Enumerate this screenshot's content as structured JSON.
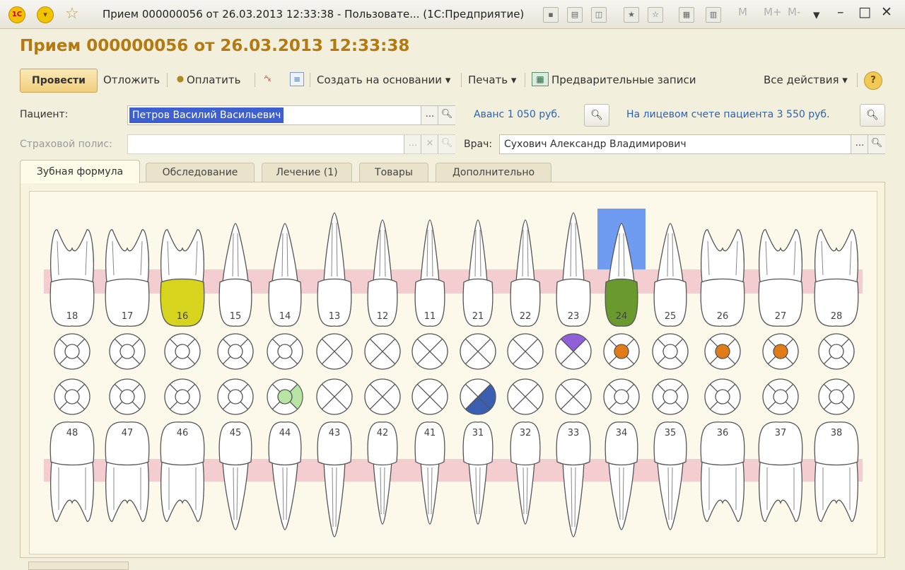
{
  "window": {
    "title": "Прием 000000056 от 26.03.2013 12:33:38 - Пользовате... (1С:Предприятие)",
    "logo_text": "1С",
    "m_buttons": [
      "M",
      "M+",
      "M-"
    ]
  },
  "document": {
    "title": "Прием 000000056 от 26.03.2013 12:33:38"
  },
  "toolbar": {
    "post_label": "Провести",
    "postpone_label": "Отложить",
    "pay_label": "Оплатить",
    "create_based_label": "Создать на основании",
    "print_label": "Печать",
    "preliminary_label": "Предварительные записи",
    "all_actions_label": "Все действия",
    "help_label": "?"
  },
  "form": {
    "patient_label": "Пациент:",
    "patient_value": "Петров Василий Васильевич",
    "advance_link": "Аванс 1 050 руб.",
    "account_link": "На лицевом счете пациента 3 550 руб.",
    "policy_label": "Страховой полис:",
    "policy_value": "",
    "doctor_label": "Врач:",
    "doctor_value": "Сухович Александр Владимирович",
    "dots": "...",
    "clear": "×"
  },
  "tabs": [
    "Зубная формула",
    "Обследование",
    "Лечение (1)",
    "Товары",
    "Дополнительно"
  ],
  "colors": {
    "accent": "#b47a10",
    "selection": "#3d5fd0",
    "gum": "#f2c6cc",
    "link": "#2b63b0",
    "highlight": "#6f9cf0"
  },
  "dental_chart": {
    "upper": [
      {
        "num": "18",
        "kind": "molar"
      },
      {
        "num": "17",
        "kind": "molar"
      },
      {
        "num": "16",
        "kind": "molar",
        "crown": "#d6d41c"
      },
      {
        "num": "15",
        "kind": "premolar"
      },
      {
        "num": "14",
        "kind": "premolar"
      },
      {
        "num": "13",
        "kind": "canine",
        "x_mark": true
      },
      {
        "num": "12",
        "kind": "incisor",
        "x_mark": true
      },
      {
        "num": "11",
        "kind": "incisor",
        "x_mark": true
      },
      {
        "num": "21",
        "kind": "incisor",
        "x_mark": true
      },
      {
        "num": "22",
        "kind": "incisor",
        "x_mark": true
      },
      {
        "num": "23",
        "kind": "canine",
        "x_mark": true,
        "top": "#9060d8"
      },
      {
        "num": "24",
        "kind": "premolar",
        "crown": "#6a9a2e",
        "center": "#e07b18",
        "selected": true
      },
      {
        "num": "25",
        "kind": "premolar"
      },
      {
        "num": "26",
        "kind": "molar",
        "center": "#e07b18"
      },
      {
        "num": "27",
        "kind": "molar",
        "center": "#e07b18"
      },
      {
        "num": "28",
        "kind": "molar"
      }
    ],
    "lower": [
      {
        "num": "48",
        "kind": "molar"
      },
      {
        "num": "47",
        "kind": "molar"
      },
      {
        "num": "46",
        "kind": "molar"
      },
      {
        "num": "45",
        "kind": "premolar"
      },
      {
        "num": "44",
        "kind": "premolar",
        "center": "#b8e4a4",
        "right": "#b8e4a4"
      },
      {
        "num": "43",
        "kind": "canine",
        "x_mark": true
      },
      {
        "num": "42",
        "kind": "incisor",
        "x_mark": true
      },
      {
        "num": "41",
        "kind": "incisor",
        "x_mark": true
      },
      {
        "num": "31",
        "kind": "incisor",
        "x_mark": true,
        "right": "#3b5fb0",
        "bottom": "#3b5fb0"
      },
      {
        "num": "32",
        "kind": "incisor",
        "x_mark": true
      },
      {
        "num": "33",
        "kind": "canine",
        "x_mark": true
      },
      {
        "num": "34",
        "kind": "premolar"
      },
      {
        "num": "35",
        "kind": "premolar"
      },
      {
        "num": "36",
        "kind": "molar"
      },
      {
        "num": "37",
        "kind": "molar"
      },
      {
        "num": "38",
        "kind": "molar"
      }
    ]
  }
}
